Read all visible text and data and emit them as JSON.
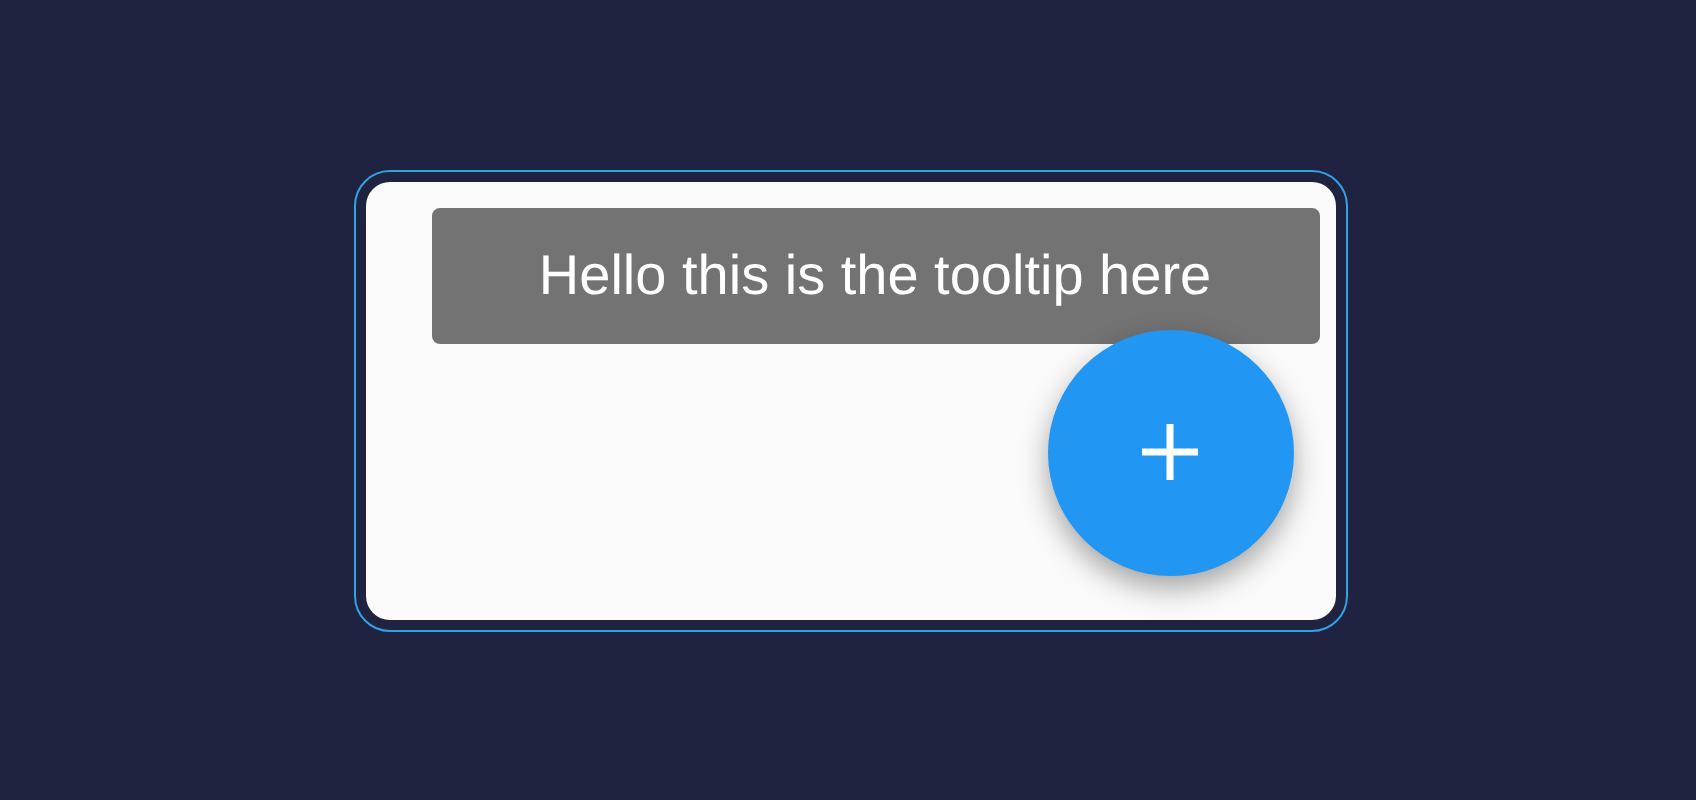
{
  "tooltip": {
    "text": "Hello this is the tooltip here"
  }
}
